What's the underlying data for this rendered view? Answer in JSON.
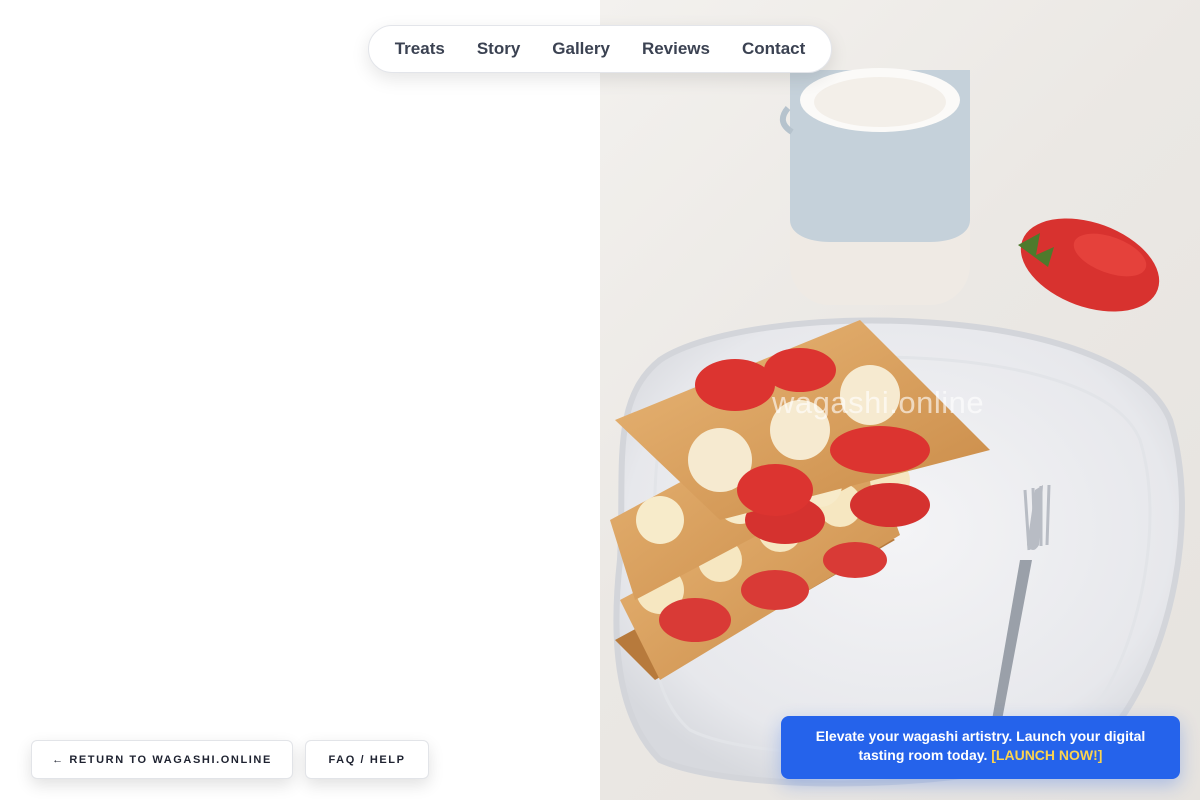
{
  "nav": {
    "items": [
      {
        "label": "Treats"
      },
      {
        "label": "Story"
      },
      {
        "label": "Gallery"
      },
      {
        "label": "Reviews"
      },
      {
        "label": "Contact"
      }
    ]
  },
  "hero": {
    "watermark": "wagashi.online",
    "image_subject": "strawberry mille-feuille pastry on white plate with fork, milk jug and a strawberry"
  },
  "footer_buttons": {
    "return_label": "← RETURN TO WAGASHI.ONLINE",
    "faq_label": "FAQ / HELP"
  },
  "cta": {
    "text": "Elevate your wagashi artistry. Launch your digital tasting room today.",
    "link": "[LAUNCH NOW!]"
  },
  "colors": {
    "cta_background": "#2563eb",
    "cta_link": "#fcd34d",
    "nav_text": "#3b4252"
  }
}
